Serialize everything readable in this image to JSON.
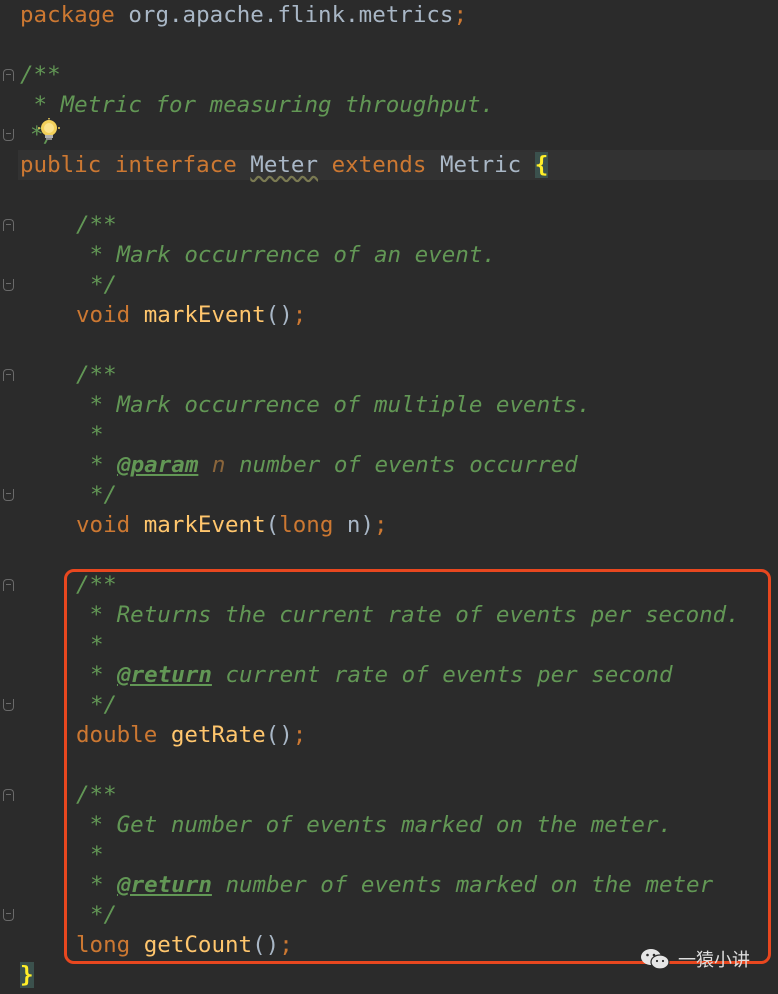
{
  "code": {
    "package_kw": "package",
    "package_name": "org.apache.flink.metrics",
    "semicolon": ";",
    "doc_open": "/**",
    "doc_close": "*/",
    "doc_star": "*",
    "class_doc": " * Metric for measuring throughput.",
    "kw_public": "public",
    "kw_interface": "interface",
    "iface_name": "Meter",
    "kw_extends": "extends",
    "super_name": "Metric",
    "open_brace": "{",
    "close_brace": "}",
    "m1_doc": " * Mark occurrence of an event.",
    "m1_type": "void",
    "m1_name": "markEvent",
    "m1_args": "()",
    "m2_doc": " * Mark occurrence of multiple events.",
    "m2_tag": "@param",
    "m2_param": "n",
    "m2_param_desc": " number of events occurred",
    "m2_type": "void",
    "m2_name": "markEvent",
    "m2_open": "(",
    "m2_argtype": "long",
    "m2_arg": " n",
    "m2_close": ")",
    "m3_doc": " * Returns the current rate of events per second.",
    "m3_tag": "@return",
    "m3_desc": " current rate of events per second",
    "m3_type": "double",
    "m3_name": "getRate",
    "m3_args": "()",
    "m4_doc": " * Get number of events marked on the meter.",
    "m4_tag": "@return",
    "m4_desc": " number of events marked on the meter",
    "m4_type": "long",
    "m4_name": "getCount",
    "m4_args": "()"
  },
  "watermark": {
    "text": "一猿小讲",
    "icon": "wechat-icon"
  },
  "colors": {
    "background": "#2b2b2b",
    "keyword": "#cc7832",
    "method": "#ffc66d",
    "doc_comment": "#629755",
    "highlight_border": "#e8471f"
  }
}
